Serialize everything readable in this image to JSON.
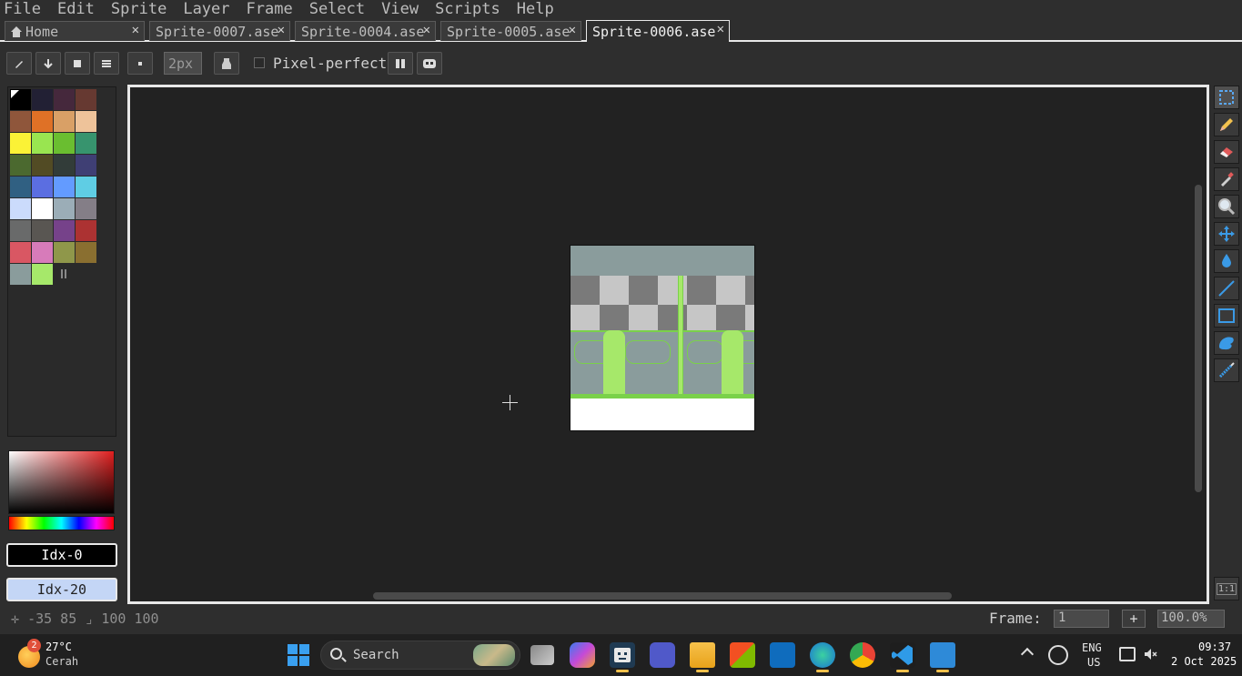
{
  "menu": [
    "File",
    "Edit",
    "Sprite",
    "Layer",
    "Frame",
    "Select",
    "View",
    "Scripts",
    "Help"
  ],
  "tabs": [
    {
      "label": "Home"
    },
    {
      "label": "Sprite-0007.ase"
    },
    {
      "label": "Sprite-0004.ase"
    },
    {
      "label": "Sprite-0005.ase"
    },
    {
      "label": "Sprite-0006.ase",
      "active": true
    }
  ],
  "context_bar": {
    "brush_size": "2px",
    "pixel_perfect_label": "Pixel-perfect",
    "pixel_perfect_checked": false
  },
  "palette": {
    "colors": [
      "#000000",
      "#222034",
      "#45283c",
      "#663931",
      "#8f563b",
      "#df7126",
      "#d9a066",
      "#eec39a",
      "#fbf236",
      "#99e550",
      "#6abe30",
      "#37946e",
      "#4b692f",
      "#524b24",
      "#323c39",
      "#3f3f74",
      "#306082",
      "#5b6ee1",
      "#639bff",
      "#5fcde4",
      "#cbdbfc",
      "#ffffff",
      "#9badb7",
      "#847e87",
      "#696a6a",
      "#595652",
      "#76428a",
      "#ac3232",
      "#d95763",
      "#d77bba",
      "#8f974a",
      "#8a6f30",
      "#8a9c9c",
      "#a6e86a"
    ],
    "selected_index": 0
  },
  "colors": {
    "foreground_label": "Idx-0",
    "background_label": "Idx-20",
    "foreground": "#000000",
    "background": "#c4d6f6"
  },
  "tools": [
    "selection-icon",
    "pencil-icon",
    "eraser-icon",
    "eyedropper-icon",
    "zoom-icon",
    "move-icon",
    "paint-bucket-icon",
    "line-icon",
    "rectangle-icon",
    "contour-icon",
    "blur-icon"
  ],
  "status": {
    "coords": "-35  85",
    "size": "100  100",
    "frame_label": "Frame:",
    "frame_value": "1",
    "add_label": "+",
    "zoom": "100.0%"
  },
  "taskbar": {
    "weather_badge": "2",
    "temperature": "27°C",
    "weather_desc": "Cerah",
    "search_label": "Search",
    "lang_line1": "ENG",
    "lang_line2": "US",
    "time": "09:37",
    "date": "2 Oct 2025",
    "reset_zoom_label": "1:1"
  }
}
